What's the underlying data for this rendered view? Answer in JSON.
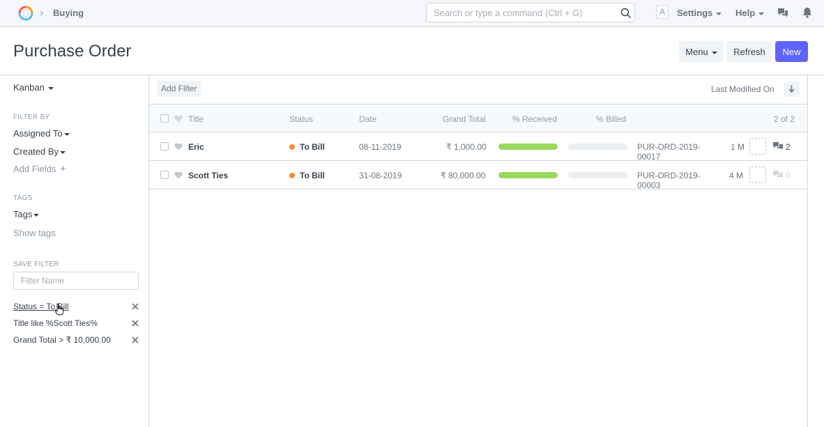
{
  "navbar": {
    "breadcrumb": "Buying",
    "search_placeholder": "Search or type a command (Ctrl + G)",
    "avatar_letter": "A",
    "settings": "Settings",
    "help": "Help"
  },
  "page": {
    "title": "Purchase Order",
    "menu_label": "Menu",
    "refresh_label": "Refresh",
    "new_label": "New"
  },
  "sidebar": {
    "view": "Kanban",
    "filter_by_label": "FILTER BY",
    "assigned_to": "Assigned To",
    "created_by": "Created By",
    "add_fields": "Add Fields",
    "tags_label": "TAGS",
    "tags": "Tags",
    "show_tags": "Show tags",
    "save_filter_label": "SAVE FILTER",
    "filter_name_placeholder": "Filter Name",
    "saved_filters": [
      "Status = To Bill",
      "Title like %Scott Ties%",
      "Grand Total > ₹ 10,000.00"
    ]
  },
  "toolbar": {
    "add_filter": "Add Filter",
    "sort_label": "Last Modified On"
  },
  "list": {
    "columns": [
      "Title",
      "Status",
      "Date",
      "Grand Total",
      "% Received",
      "% Billed"
    ],
    "count": "2 of 2",
    "rows": [
      {
        "title": "Eric",
        "status": "To Bill",
        "date": "08-11-2019",
        "grand_total": "₹ 1,000.00",
        "received": 100,
        "billed": 0,
        "name": "PUR-ORD-2019-00017",
        "modified": "1 M",
        "comments": "2"
      },
      {
        "title": "Scott Ties",
        "status": "To Bill",
        "date": "31-08-2019",
        "grand_total": "₹ 80,000.00",
        "received": 100,
        "billed": 0,
        "name": "PUR-ORD-2019-00003",
        "modified": "4 M",
        "comments": "0"
      }
    ]
  },
  "colors": {
    "primary": "#5e64ff",
    "status_orange": "#ff8c3a",
    "progress_green": "#98d85b"
  },
  "icons": [
    "logo-icon",
    "chevron-right-icon",
    "search-icon",
    "caret-down-icon",
    "chat-icon",
    "bell-icon",
    "plus-icon",
    "close-icon",
    "sort-desc-icon",
    "heart-icon",
    "comment-icon",
    "hand-cursor-icon"
  ]
}
